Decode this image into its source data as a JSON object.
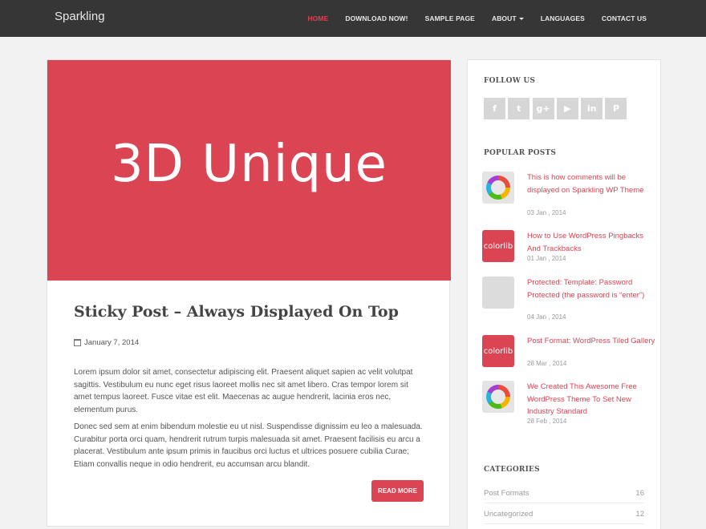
{
  "site": {
    "brand": "Sparkling"
  },
  "nav": {
    "items": [
      {
        "label": "HOME"
      },
      {
        "label": "DOWNLOAD NOW!"
      },
      {
        "label": "SAMPLE PAGE"
      },
      {
        "label": "ABOUT"
      },
      {
        "label": "LANGUAGES"
      },
      {
        "label": "CONTACT US"
      }
    ]
  },
  "colors": {
    "accent": "#da4453",
    "navbar": "#363636",
    "page_bg": "#f2f2f2"
  },
  "post": {
    "featured_text": "3D Unique",
    "title": "Sticky Post – Always Displayed On Top",
    "date": "January 7, 2014",
    "paragraph1": "Lorem ipsum dolor sit amet, consectetur adipiscing elit. Praesent aliquet sapien ac velit volutpat sagittis. Vestibulum eu nunc eget risus laoreet mollis nec sit amet libero. Cras tempor lorem sit amet tempus laoreet. Fusce vitae est elit. Maecenas ac augue hendrerit, lacinia eros nec, elementum purus.",
    "paragraph2": "Donec sed sem at enim bibendum molestie eu ut nisl. Suspendisse dignissim eu leo a malesuada. Curabitur porta orci quam, hendrerit rutrum turpis malesuada sit amet. Praesent facilisis eu arcu a placerat. Vestibulum ante ipsum primis in faucibus orci luctus et ultrices posuere cubilia Curae; Etiam convallis neque in odio hendrerit, eu accumsan arcu blandit.",
    "read_more": "READ MORE"
  },
  "sidebar": {
    "follow_title": "FOLLOW US",
    "social": [
      {
        "icon": "facebook-icon",
        "glyph": "f"
      },
      {
        "icon": "twitter-icon",
        "glyph": "t"
      },
      {
        "icon": "google-plus-icon",
        "glyph": "g+"
      },
      {
        "icon": "youtube-icon",
        "glyph": "▶"
      },
      {
        "icon": "linkedin-icon",
        "glyph": "in"
      },
      {
        "icon": "pinterest-icon",
        "glyph": "P"
      }
    ],
    "popular_title": "POPULAR POSTS",
    "popular_posts": [
      {
        "title": "This is how comments will be displayed on Sparkling WP Theme",
        "date": "03 Jan , 2014",
        "thumb": "ring"
      },
      {
        "title": "How to Use WordPress Pingbacks And Trackbacks",
        "date": "01 Jan , 2014",
        "thumb": "colorlib",
        "thumb_text": "colorlib"
      },
      {
        "title": "Protected: Template: Password Protected (the password is “enter”)",
        "date": "04 Jan , 2014",
        "thumb": "grey"
      },
      {
        "title": "Post Format: WordPress Tiled Gallery",
        "date": "28 Mar , 2014",
        "thumb": "colorlib",
        "thumb_text": "colorlib"
      },
      {
        "title": "We Created This Awesome Free WordPress Theme To Set New Industry Standard",
        "date": "28 Feb , 2014",
        "thumb": "ring"
      }
    ],
    "categories_title": "CATEGORIES",
    "categories": [
      {
        "name": "Post Formats",
        "count": "16"
      },
      {
        "name": "Uncategorized",
        "count": "12"
      }
    ]
  }
}
